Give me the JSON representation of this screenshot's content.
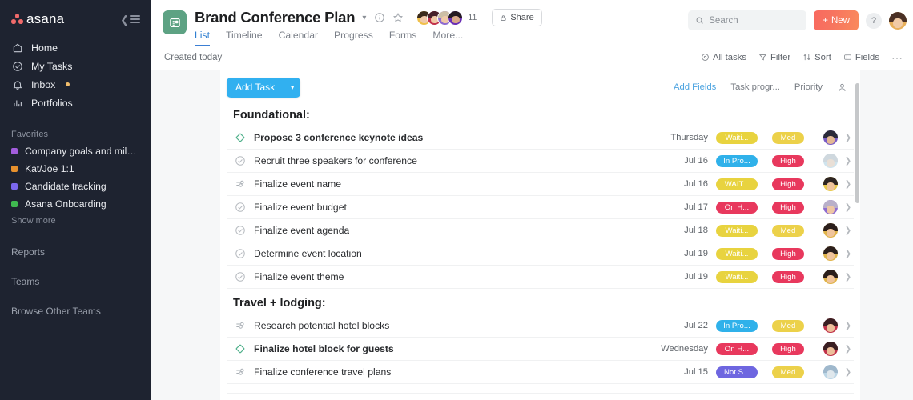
{
  "sidebar": {
    "logo_text": "asana",
    "collapse_icon": "collapse-sidebar-icon",
    "nav": [
      {
        "label": "Home",
        "icon": "home-icon"
      },
      {
        "label": "My Tasks",
        "icon": "check-circle-icon"
      },
      {
        "label": "Inbox",
        "icon": "bell-icon",
        "badge_dot": true
      },
      {
        "label": "Portfolios",
        "icon": "bar-chart-icon"
      }
    ],
    "favorites_heading": "Favorites",
    "favorites": [
      {
        "label": "Company goals and milest...",
        "color": "#a25ddc"
      },
      {
        "label": "Kat/Joe 1:1",
        "color": "#e8912d"
      },
      {
        "label": "Candidate tracking",
        "color": "#7b68ee"
      },
      {
        "label": "Asana Onboarding",
        "color": "#3fb950"
      }
    ],
    "show_more": "Show more",
    "reports": "Reports",
    "teams": "Teams",
    "browse_other_teams": "Browse Other Teams"
  },
  "header": {
    "project_icon": "project-list-icon",
    "title": "Brand Conference Plan",
    "chevron": "▾",
    "info_icon": "info-icon",
    "star_icon": "star-icon",
    "member_count": "11",
    "share_label": "Share",
    "share_icon": "lock-icon",
    "tabs": [
      {
        "label": "List",
        "active": true
      },
      {
        "label": "Timeline",
        "active": false
      },
      {
        "label": "Calendar",
        "active": false
      },
      {
        "label": "Progress",
        "active": false
      },
      {
        "label": "Forms",
        "active": false
      },
      {
        "label": "More...",
        "active": false
      }
    ],
    "search_placeholder": "Search",
    "search_icon": "search-icon",
    "new_label": "New",
    "new_plus": "+",
    "help_label": "?",
    "avatar": "user-avatar"
  },
  "subtoolbar": {
    "created": "Created today",
    "buttons": [
      {
        "label": "All tasks",
        "icon": "target-icon"
      },
      {
        "label": "Filter",
        "icon": "filter-icon"
      },
      {
        "label": "Sort",
        "icon": "sort-icon"
      },
      {
        "label": "Fields",
        "icon": "fields-icon"
      }
    ],
    "overflow": "⋯"
  },
  "list": {
    "add_task_label": "Add Task",
    "add_task_caret": "▾",
    "column_headers": [
      {
        "label": "Add Fields",
        "link": true
      },
      {
        "label": "Task progr...",
        "link": false
      },
      {
        "label": "Priority",
        "link": false
      }
    ],
    "assignee_col_icon": "person-icon",
    "sections": [
      {
        "title": "Foundational:",
        "tasks": [
          {
            "name": "Propose 3 conference keynote ideas",
            "bold": true,
            "icon": "milestone-diamond-icon",
            "date": "Thursday",
            "status": "Waiti...",
            "status_color": "#e8d33f",
            "priority": "Med",
            "priority_color": "#ecd14a",
            "avatar_hair": "#2b2b3a",
            "avatar_bg": "#7a5cc4"
          },
          {
            "name": "Recruit three speakers for conference",
            "bold": false,
            "icon": "check-circle-icon",
            "date": "Jul 16",
            "status": "In Pro...",
            "status_color": "#2fb1ea",
            "priority": "High",
            "priority_color": "#e8385d",
            "avatar_hair": "#cfd8de",
            "avatar_bg": "#cfe4ee"
          },
          {
            "name": "Finalize event name",
            "bold": false,
            "icon": "subtask-icon",
            "date": "Jul 16",
            "status": "WAIT...",
            "status_color": "#e8d33f",
            "priority": "High",
            "priority_color": "#e8385d",
            "avatar_hair": "#2e2522",
            "avatar_bg": "#e8c84c"
          },
          {
            "name": "Finalize event budget",
            "bold": false,
            "icon": "check-circle-icon",
            "date": "Jul 17",
            "status": "On H...",
            "status_color": "#e8385d",
            "priority": "High",
            "priority_color": "#e8385d",
            "avatar_hair": "#b9b0c9",
            "avatar_bg": "#8e6bd0"
          },
          {
            "name": "Finalize event agenda",
            "bold": false,
            "icon": "check-circle-icon",
            "date": "Jul 18",
            "status": "Waiti...",
            "status_color": "#e8d33f",
            "priority": "Med",
            "priority_color": "#ecd14a",
            "avatar_hair": "#2b1f1c",
            "avatar_bg": "#e0b44a"
          },
          {
            "name": "Determine event location",
            "bold": false,
            "icon": "check-circle-icon",
            "date": "Jul 19",
            "status": "Waiti...",
            "status_color": "#e8d33f",
            "priority": "High",
            "priority_color": "#e8385d",
            "avatar_hair": "#2b1f1c",
            "avatar_bg": "#e0b44a"
          },
          {
            "name": "Finalize event theme",
            "bold": false,
            "icon": "check-circle-icon",
            "date": "Jul 19",
            "status": "Waiti...",
            "status_color": "#e8d33f",
            "priority": "High",
            "priority_color": "#e8385d",
            "avatar_hair": "#2b1f1c",
            "avatar_bg": "#e0b44a"
          }
        ]
      },
      {
        "title": "Travel + lodging:",
        "tasks": [
          {
            "name": "Research potential hotel blocks",
            "bold": false,
            "icon": "subtask-icon",
            "date": "Jul 22",
            "status": "In Pro...",
            "status_color": "#2fb1ea",
            "priority": "Med",
            "priority_color": "#ecd14a",
            "avatar_hair": "#3a1f22",
            "avatar_bg": "#c0324a"
          },
          {
            "name": "Finalize hotel block for guests",
            "bold": true,
            "icon": "milestone-diamond-icon",
            "date": "Wednesday",
            "status": "On H...",
            "status_color": "#e8385d",
            "priority": "High",
            "priority_color": "#e8385d",
            "avatar_hair": "#3a1f22",
            "avatar_bg": "#c0324a"
          },
          {
            "name": "Finalize conference travel plans",
            "bold": false,
            "icon": "subtask-icon",
            "date": "Jul 15",
            "status": "Not S...",
            "status_color": "#6e66e0",
            "priority": "Med",
            "priority_color": "#ecd14a",
            "avatar_hair": "#9fb8cc",
            "avatar_bg": "#bcd6e6"
          }
        ]
      }
    ]
  }
}
